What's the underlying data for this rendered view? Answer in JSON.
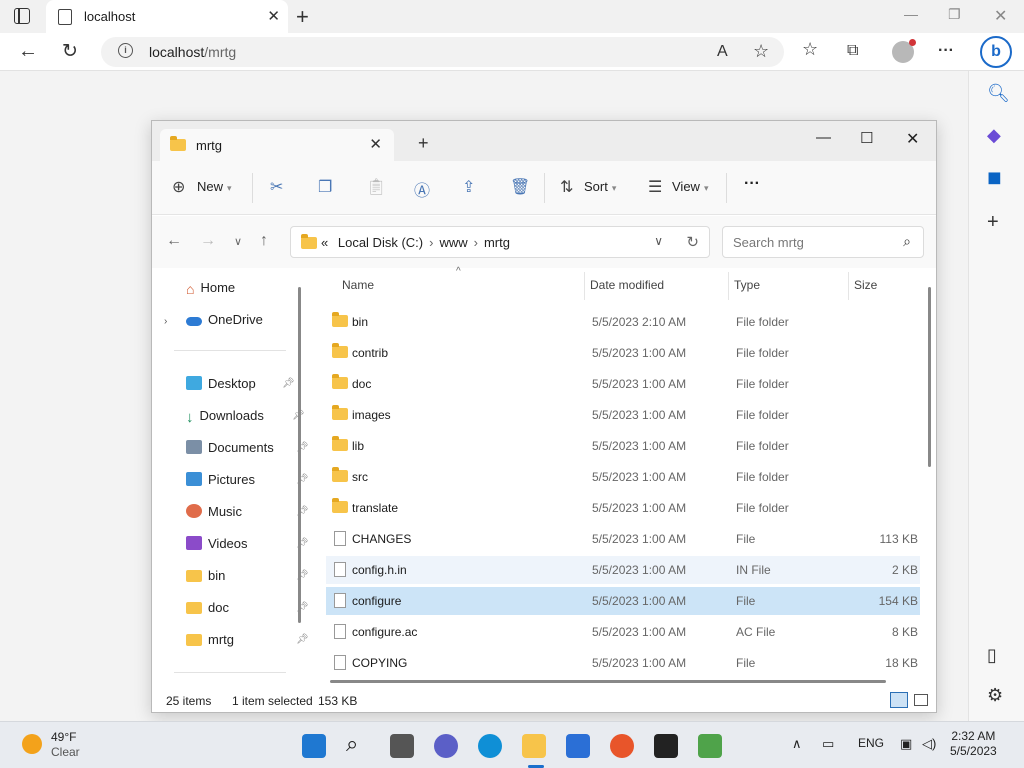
{
  "browser": {
    "tab_title": "localhost",
    "url_host": "localhost",
    "url_path": "/mrtg"
  },
  "explorer": {
    "tab_title": "mrtg",
    "toolbar": {
      "new_label": "New",
      "sort_label": "Sort",
      "view_label": "View",
      "more_label": "···"
    },
    "breadcrumb": {
      "prefix": "«",
      "parts": [
        "Local Disk (C:)",
        "www",
        "mrtg"
      ]
    },
    "search_placeholder": "Search mrtg",
    "nav": {
      "home": "Home",
      "onedrive": "OneDrive",
      "desktop": "Desktop",
      "downloads": "Downloads",
      "documents": "Documents",
      "pictures": "Pictures",
      "music": "Music",
      "videos": "Videos",
      "bin": "bin",
      "doc": "doc",
      "mrtg": "mrtg"
    },
    "columns": {
      "name": "Name",
      "date": "Date modified",
      "type": "Type",
      "size": "Size"
    },
    "files": [
      {
        "name": "bin",
        "date": "5/5/2023 2:10 AM",
        "type": "File folder",
        "size": ""
      },
      {
        "name": "contrib",
        "date": "5/5/2023 1:00 AM",
        "type": "File folder",
        "size": ""
      },
      {
        "name": "doc",
        "date": "5/5/2023 1:00 AM",
        "type": "File folder",
        "size": ""
      },
      {
        "name": "images",
        "date": "5/5/2023 1:00 AM",
        "type": "File folder",
        "size": ""
      },
      {
        "name": "lib",
        "date": "5/5/2023 1:00 AM",
        "type": "File folder",
        "size": ""
      },
      {
        "name": "src",
        "date": "5/5/2023 1:00 AM",
        "type": "File folder",
        "size": ""
      },
      {
        "name": "translate",
        "date": "5/5/2023 1:00 AM",
        "type": "File folder",
        "size": ""
      },
      {
        "name": "CHANGES",
        "date": "5/5/2023 1:00 AM",
        "type": "File",
        "size": "113 KB"
      },
      {
        "name": "config.h.in",
        "date": "5/5/2023 1:00 AM",
        "type": "IN File",
        "size": "2 KB"
      },
      {
        "name": "configure",
        "date": "5/5/2023 1:00 AM",
        "type": "File",
        "size": "154 KB"
      },
      {
        "name": "configure.ac",
        "date": "5/5/2023 1:00 AM",
        "type": "AC File",
        "size": "8 KB"
      },
      {
        "name": "COPYING",
        "date": "5/5/2023 1:00 AM",
        "type": "File",
        "size": "18 KB"
      }
    ],
    "status": {
      "items": "25 items",
      "selected": "1 item selected",
      "size": "153 KB"
    }
  },
  "taskbar": {
    "weather_temp": "49°F",
    "weather_desc": "Clear",
    "lang": "ENG",
    "time": "2:32 AM",
    "date": "5/5/2023"
  },
  "colors": {
    "selection": "#cce4f7",
    "folder": "#f7c44a",
    "accent": "#1a6fcc"
  }
}
